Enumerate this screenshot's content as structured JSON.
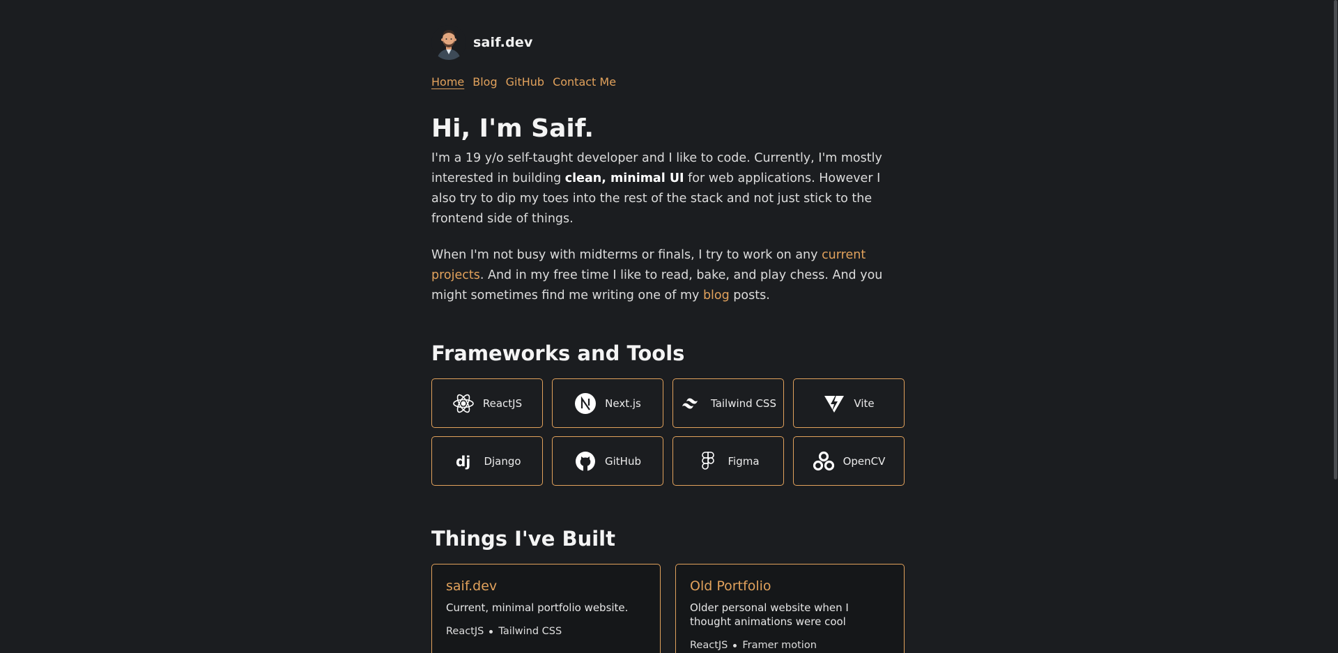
{
  "site": {
    "brand": "saif.dev"
  },
  "nav": {
    "items": [
      "Home",
      "Blog",
      "GitHub",
      "Contact Me"
    ],
    "active": "Home"
  },
  "hero": {
    "title": "Hi, I'm Saif.",
    "para1": {
      "before": "I'm a 19 y/o self-taught developer and I like to code. Currently, I'm mostly interested in building ",
      "bold": "clean, minimal UI",
      "after": " for web applications. However I also try to dip my toes into the rest of the stack and not just stick to the frontend side of things."
    },
    "para2": {
      "before": "When I'm not busy with midterms or finals, I try to work on any ",
      "link1": "current projects",
      "middle": ". And in my free time I like to read, bake, and play chess. And you might sometimes find me writing one of my ",
      "link2": "blog",
      "after": " posts."
    }
  },
  "tools": {
    "heading": "Frameworks and Tools",
    "items": [
      {
        "label": "ReactJS",
        "icon": "react-icon"
      },
      {
        "label": "Next.js",
        "icon": "nextjs-icon"
      },
      {
        "label": "Tailwind CSS",
        "icon": "tailwind-icon"
      },
      {
        "label": "Vite",
        "icon": "vite-icon"
      },
      {
        "label": "Django",
        "icon": "django-icon"
      },
      {
        "label": "GitHub",
        "icon": "github-icon"
      },
      {
        "label": "Figma",
        "icon": "figma-icon"
      },
      {
        "label": "OpenCV",
        "icon": "opencv-icon"
      }
    ]
  },
  "projects": {
    "heading": "Things I've Built",
    "items": [
      {
        "title": "saif.dev",
        "description": "Current, minimal portfolio website.",
        "stack": [
          "ReactJS",
          "Tailwind CSS"
        ]
      },
      {
        "title": "Old Portfolio",
        "description": "Older personal website when I thought animations were cool",
        "stack": [
          "ReactJS",
          "Framer motion"
        ]
      }
    ]
  },
  "colors": {
    "background": "#1b1d20",
    "accent": "#e2a25c",
    "text": "#e8e8e8"
  }
}
